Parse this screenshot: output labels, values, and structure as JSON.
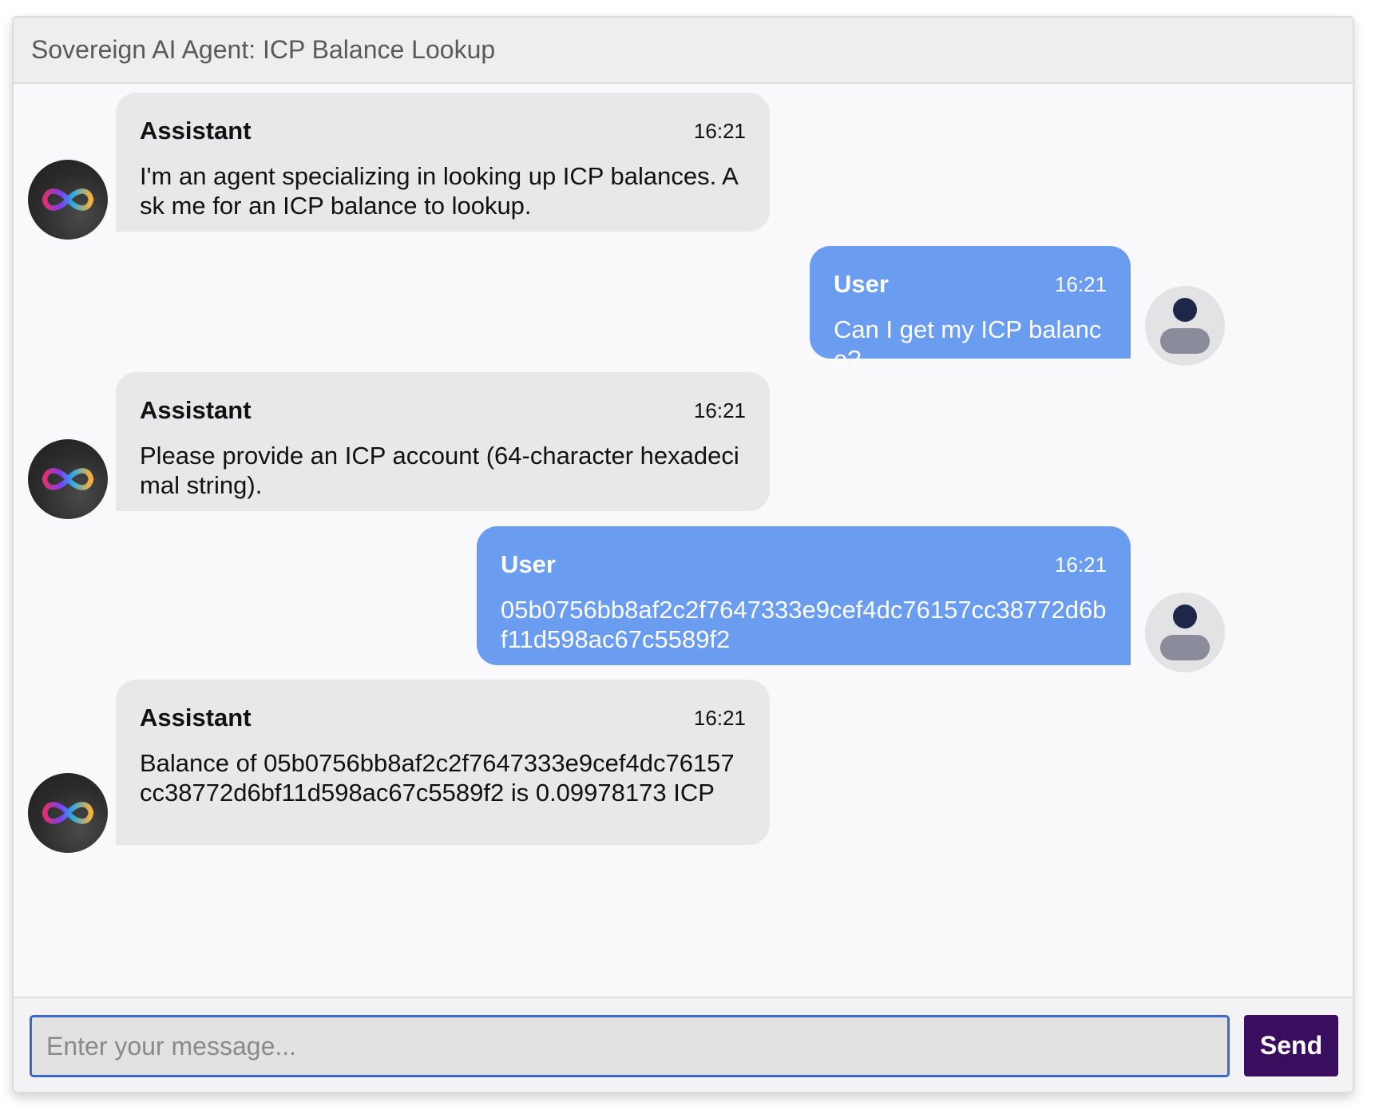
{
  "header": {
    "title": "Sovereign AI Agent: ICP Balance Lookup"
  },
  "messages": [
    {
      "role": "assistant",
      "sender": "Assistant",
      "time": "16:21",
      "text": "I'm an agent specializing in looking up ICP balances. Ask me for an ICP balance to lookup."
    },
    {
      "role": "user",
      "sender": "User",
      "time": "16:21",
      "text": "Can I get my ICP balance?"
    },
    {
      "role": "assistant",
      "sender": "Assistant",
      "time": "16:21",
      "text": "Please provide an ICP account (64-character hexadecimal string)."
    },
    {
      "role": "user",
      "sender": "User",
      "time": "16:21",
      "text": "05b0756bb8af2c2f7647333e9cef4dc76157cc38772d6bf11d598ac67c5589f2"
    },
    {
      "role": "assistant",
      "sender": "Assistant",
      "time": "16:21",
      "text": "Balance of 05b0756bb8af2c2f7647333e9cef4dc76157cc38772d6bf11d598ac67c5589f2 is 0.09978173 ICP"
    }
  ],
  "avatars": {
    "assistant": "icp-infinity-logo-icon",
    "user": "user-silhouette-icon"
  },
  "composer": {
    "value": "",
    "placeholder": "Enter your message...",
    "send_label": "Send"
  },
  "colors": {
    "user_bubble": "#6a9cf0",
    "assistant_bubble": "#e8e8ea",
    "send_button": "#3a0e5e",
    "input_border": "#3b67c8"
  }
}
